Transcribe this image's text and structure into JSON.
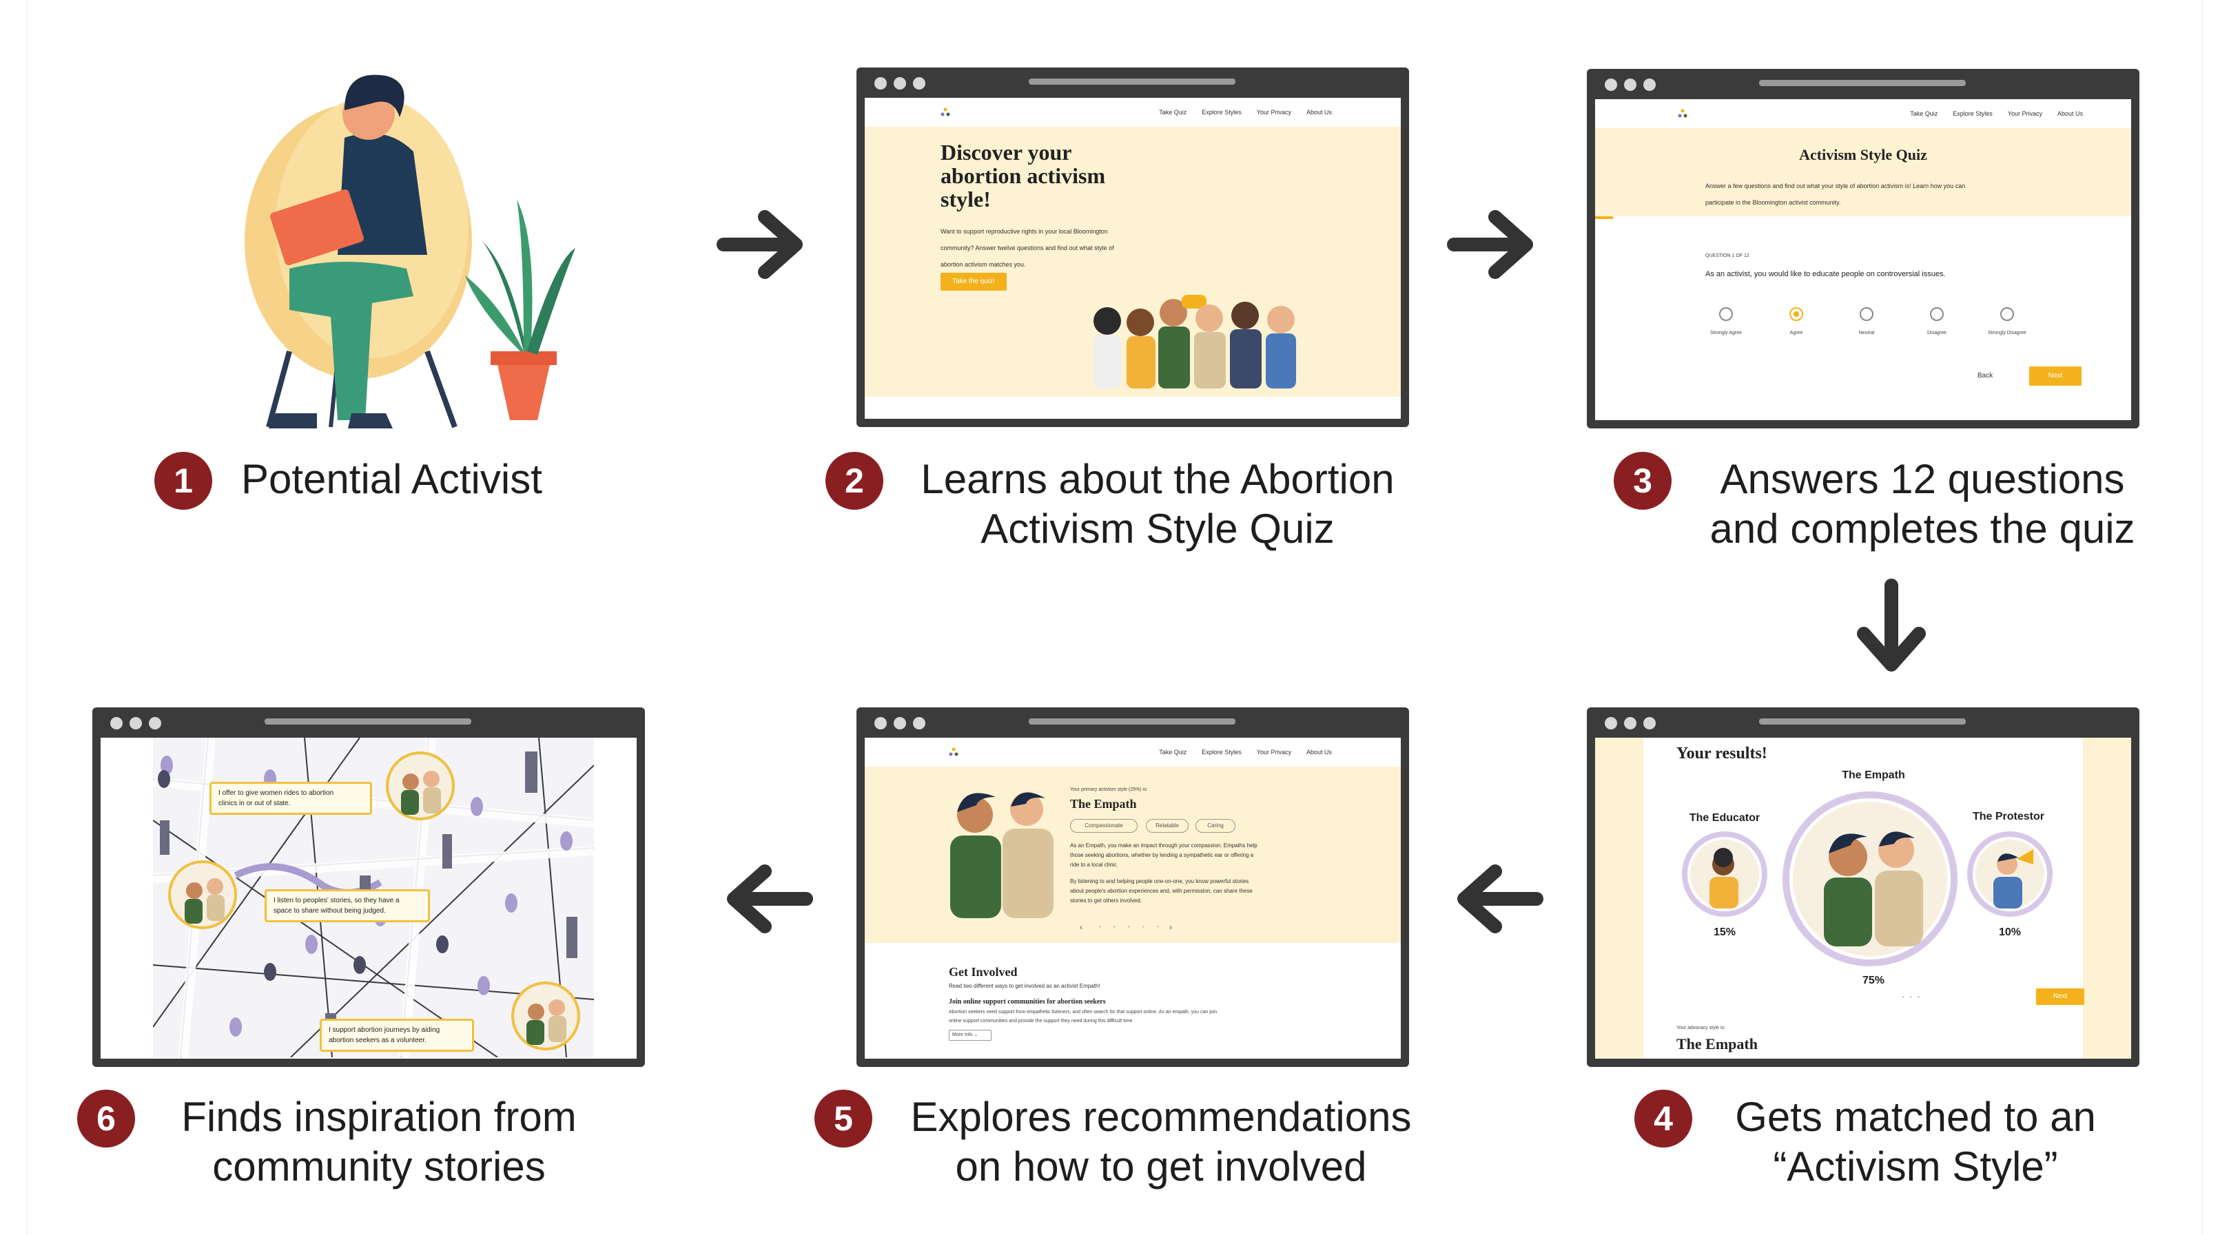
{
  "steps": [
    {
      "number": "1",
      "caption": [
        "Potential Activist"
      ]
    },
    {
      "number": "2",
      "caption": [
        "Learns about the Abortion",
        "Activism Style Quiz"
      ]
    },
    {
      "number": "3",
      "caption": [
        "Answers 12 questions",
        "and completes the quiz"
      ]
    },
    {
      "number": "4",
      "caption": [
        "Gets matched to an",
        "“Activism Style”"
      ]
    },
    {
      "number": "5",
      "caption": [
        "Explores recommendations",
        "on how to get involved"
      ]
    },
    {
      "number": "6",
      "caption": [
        "Finds inspiration from",
        "community stories"
      ]
    }
  ],
  "nav": [
    "Take Quiz",
    "Explore Styles",
    "Your Privacy",
    "About Us"
  ],
  "landing": {
    "headline": [
      "Discover your",
      "abortion activism",
      "style!"
    ],
    "body": [
      "Want to support reproductive rights in your local Bloomington",
      "community? Answer twelve questions and find out what style of",
      "abortion activism matches you."
    ],
    "button": "Take the quiz!"
  },
  "quiz": {
    "title": "Activism Style Quiz",
    "intro": [
      "Answer a few questions and find out what your style of abortion activism is! Learn how you can",
      "participate in the Bloomington activist community."
    ],
    "counter": "QUESTION 1 OF 12",
    "question": "As an activist, you would like to educate people on controversial issues.",
    "options": [
      "Strongly Agree",
      "Agree",
      "Neutral",
      "Disagree",
      "Strongly Disagree"
    ],
    "selected_index": 1,
    "back": "Back",
    "next": "Next"
  },
  "results": {
    "heading": "Your results!",
    "primary": {
      "name": "The Empath",
      "percent": "75%"
    },
    "left": {
      "name": "The Educator",
      "percent": "15%"
    },
    "right": {
      "name": "The Protestor",
      "percent": "10%"
    },
    "next": "Next",
    "small": "Your advocacy style is:",
    "bottom": "The Empath"
  },
  "style_page": {
    "kicker": "Your primary activism style (25%) is:",
    "name": "The Empath",
    "tags": [
      "Compassionate",
      "Relatable",
      "Caring"
    ],
    "desc1": [
      "As an Empath, you make an impact through your compassion. Empaths help",
      "those seeking abortions, whether by lending a sympathetic ear or offering a",
      "ride to a local clinic."
    ],
    "desc2": [
      "By listening to and helping people one-on-one, you know powerful stories",
      "about people's abortion experiences and, with permission, can share these",
      "stories to get others involved."
    ],
    "get_involved": "Get Involved",
    "gi_sub": "Read two different ways to get involved as an activist Empath!",
    "gi_item": "Join online support communities for abortion seekers",
    "gi_text": [
      "Abortion seekers need support from empathetic listeners, and often search for that support online. As an empath, you can join",
      "online support communities and provide the support they need during this difficult time."
    ],
    "more": "More Info"
  },
  "stories": [
    [
      "I offer to give women rides to abortion",
      "clinics in or out of state."
    ],
    [
      "I listen to peoples' stories, so they have a",
      "space to share without being judged."
    ],
    [
      "I support abortion journeys by aiding",
      "abortion seekers as a volunteer."
    ]
  ],
  "colors": {
    "accent": "#f3b21b",
    "badge": "#8a1f22",
    "cream": "#fdf2d1",
    "frame": "#3b3b3b",
    "green": "#3f6b3a",
    "purple": "#d8c8e8"
  }
}
